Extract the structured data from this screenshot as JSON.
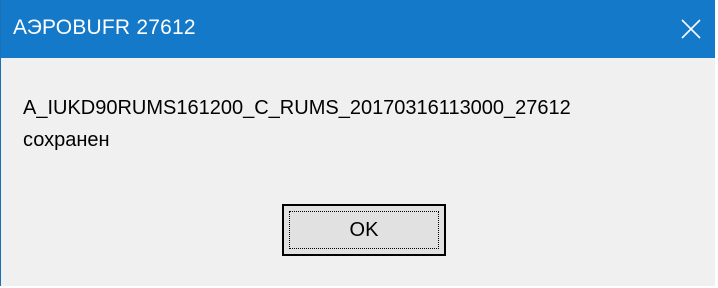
{
  "window": {
    "title": "АЭРОBUFR 27612",
    "close_icon": "close-icon",
    "titlebar_color": "#1479c8"
  },
  "message": {
    "line1": "A_IUKD90RUMS161200_C_RUMS_20170316113000_27612",
    "line2": "сохранен"
  },
  "buttons": {
    "ok_label": "OK"
  }
}
